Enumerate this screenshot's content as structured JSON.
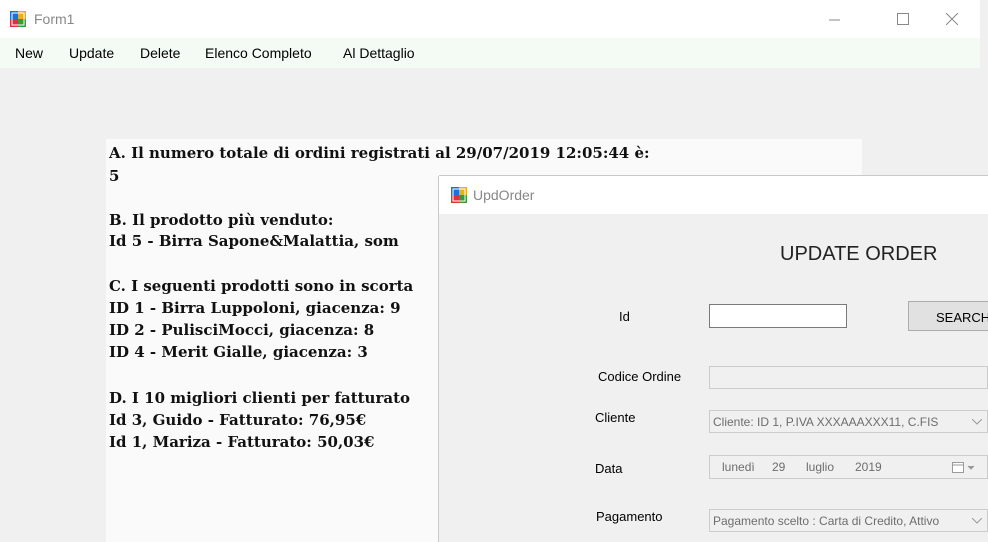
{
  "form1": {
    "title": "Form1",
    "menu": [
      "New",
      "Update",
      "Delete",
      "Elenco Completo",
      "Al Dettaglio"
    ],
    "report_lines": [
      "A. Il numero totale di ordini registrati al 29/07/2019 12:05:44 è:",
      "5",
      "B. Il prodotto più venduto:",
      "Id 5 - Birra Sapone&Malattia, som",
      "C. I seguenti prodotti sono in scorta",
      "ID 1 - Birra Luppoloni, giacenza: 9",
      "ID 2 - PulisciMocci, giacenza: 8",
      "ID 4 - Merit Gialle, giacenza: 3",
      "D. I 10 migliori clienti per fatturato",
      "Id 3, Guido - Fatturato: 76,95€",
      "Id 1, Mariza - Fatturato: 50,03€"
    ]
  },
  "upd_order": {
    "title": "UpdOrder",
    "header": "UPDATE ORDER",
    "id_label": "Id",
    "id_value": "",
    "search_label": "SEARCH",
    "codice_label": "Codice Ordine",
    "codice_value": "",
    "cliente_label": "Cliente",
    "cliente_value": "Cliente: ID 1, P.IVA XXXAAAXXX11, C.FIS",
    "data_label": "Data",
    "data_day_name": "lunedì",
    "data_day": "29",
    "data_month": "luglio",
    "data_year": "2019",
    "pagamento_label": "Pagamento",
    "pagamento_value": "Pagamento scelto : Carta di Credito, Attivo"
  },
  "icons": {
    "app": "winforms-app-icon",
    "minimize": "minimize-icon",
    "maximize": "maximize-icon",
    "close": "close-icon",
    "dropdown": "chevron-down-icon",
    "calendar": "calendar-icon"
  }
}
